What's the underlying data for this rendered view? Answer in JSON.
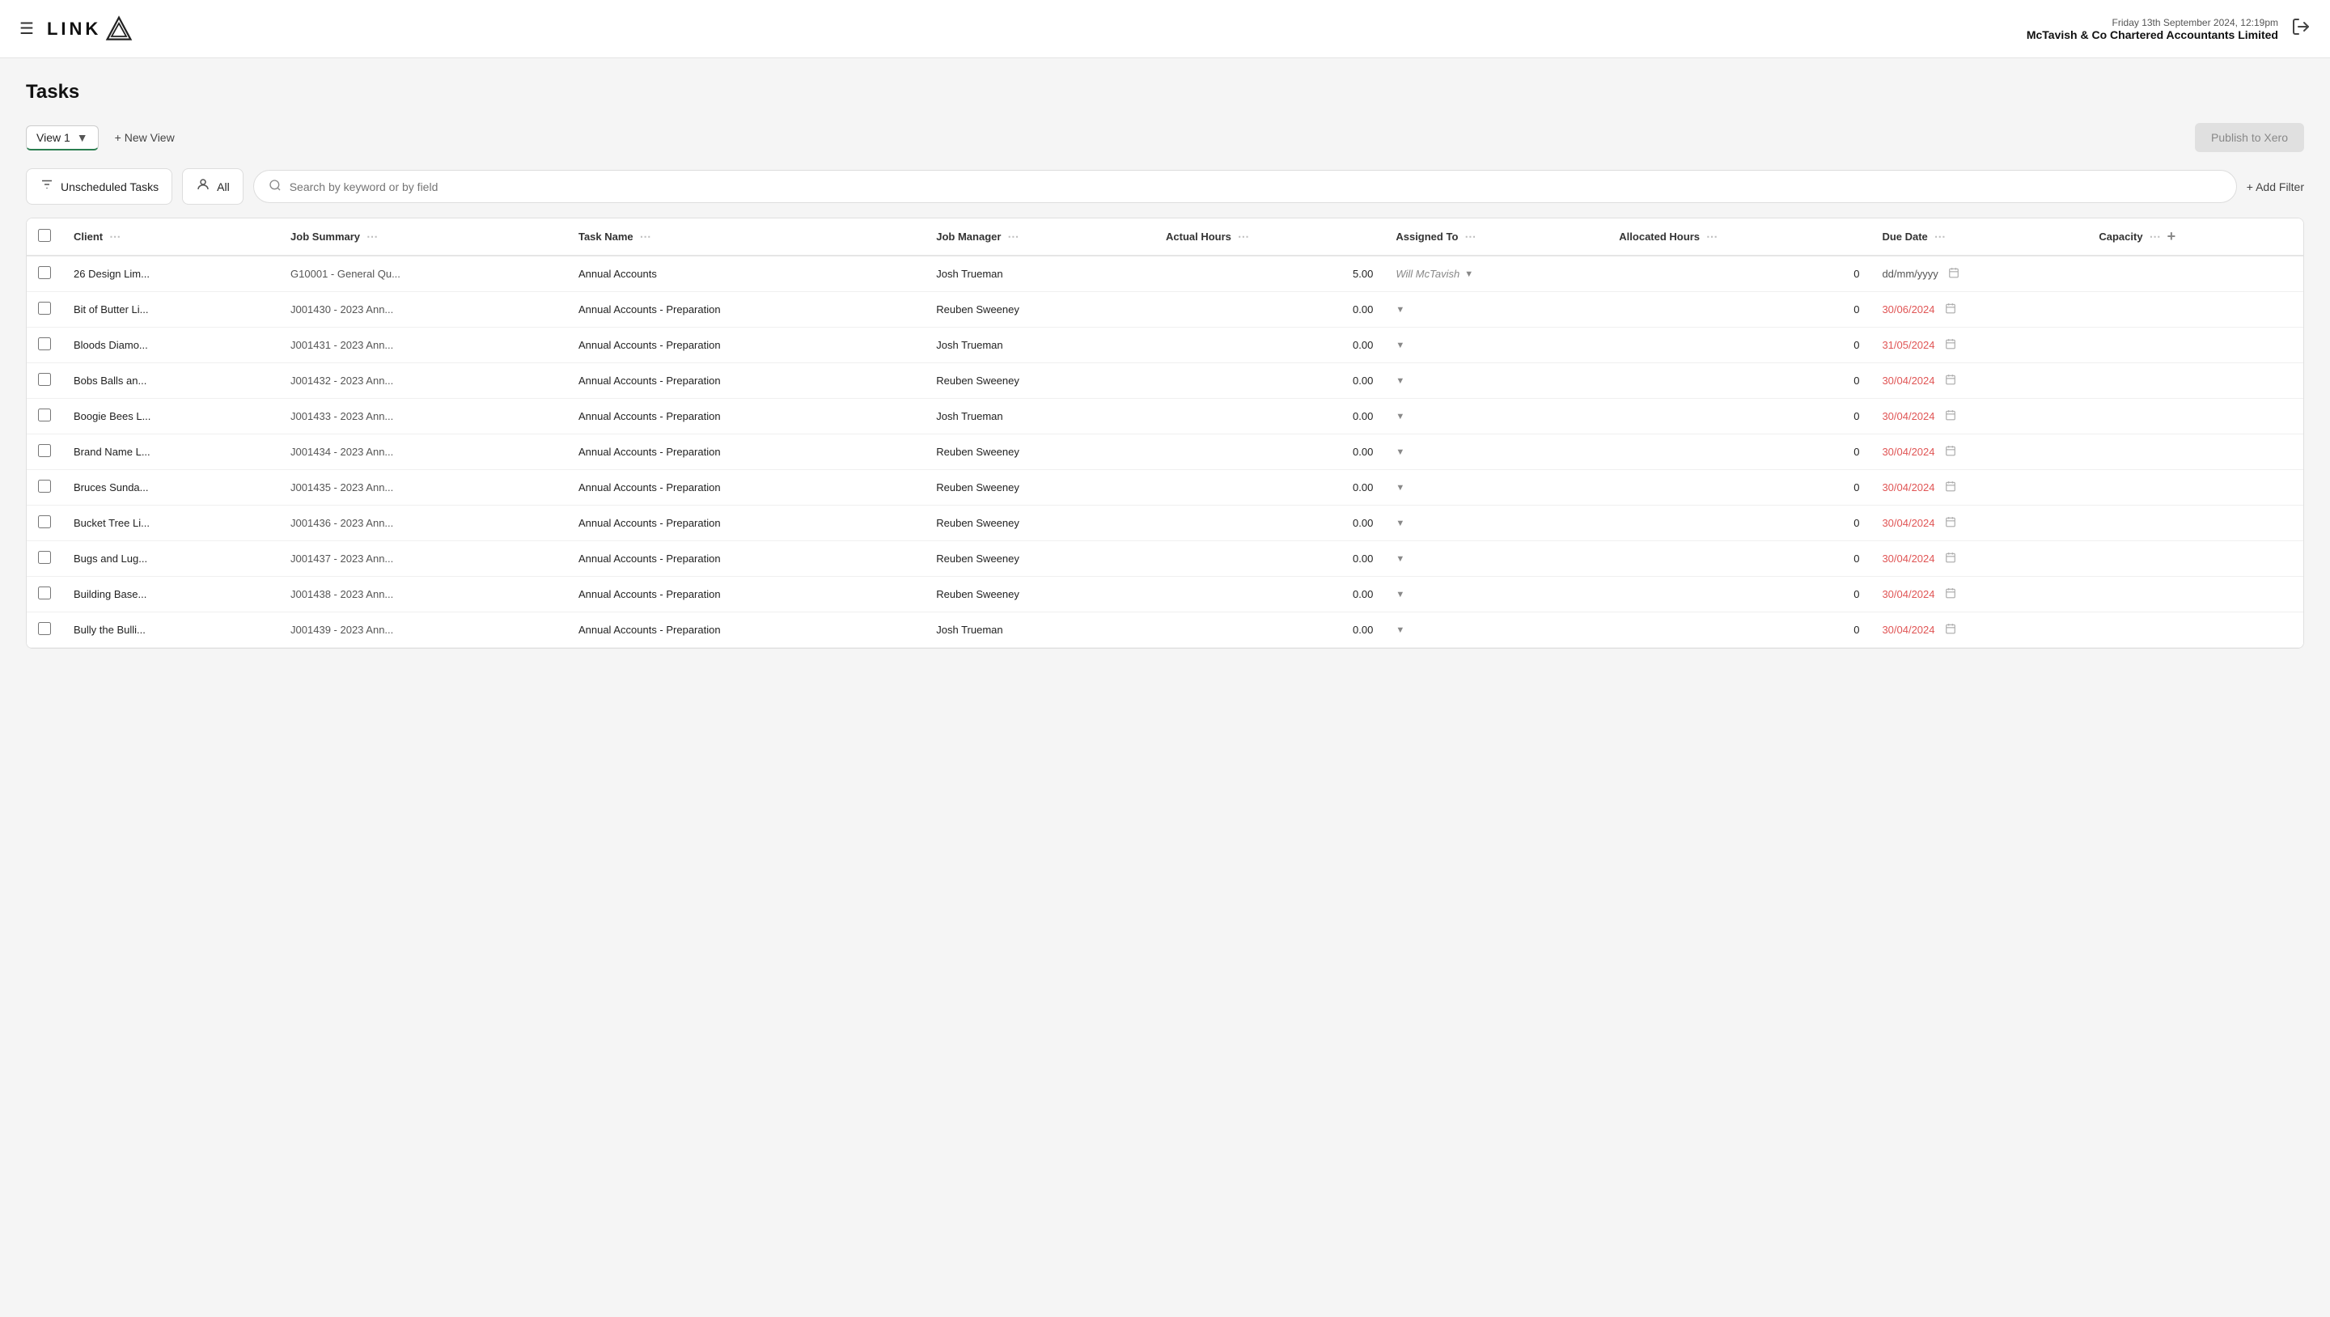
{
  "header": {
    "menu_label": "☰",
    "logo_text": "LINK",
    "date": "Friday 13th September 2024, 12:19pm",
    "company": "McTavish & Co Chartered Accountants Limited",
    "logout_icon": "→"
  },
  "page": {
    "title": "Tasks"
  },
  "toolbar": {
    "view_label": "View 1",
    "new_view_label": "+ New View",
    "publish_label": "Publish to Xero"
  },
  "filters": {
    "filter_label": "Unscheduled Tasks",
    "person_label": "All",
    "search_placeholder": "Search by keyword or by field",
    "add_filter_label": "+ Add Filter"
  },
  "table": {
    "columns": [
      {
        "id": "client",
        "label": "Client"
      },
      {
        "id": "job_summary",
        "label": "Job Summary"
      },
      {
        "id": "task_name",
        "label": "Task Name"
      },
      {
        "id": "job_manager",
        "label": "Job Manager"
      },
      {
        "id": "actual_hours",
        "label": "Actual Hours"
      },
      {
        "id": "assigned_to",
        "label": "Assigned To"
      },
      {
        "id": "allocated_hours",
        "label": "Allocated Hours"
      },
      {
        "id": "due_date",
        "label": "Due Date"
      },
      {
        "id": "capacity",
        "label": "Capacity"
      }
    ],
    "rows": [
      {
        "client": "26 Design Lim...",
        "job_summary": "G10001 - General Qu...",
        "task_name": "Annual Accounts",
        "job_manager": "Josh Trueman",
        "actual_hours": "5.00",
        "assigned_to": "Will McTavish",
        "assigned_placeholder": false,
        "allocated_hours": "0",
        "due_date": "dd/mm/yyyy",
        "due_date_overdue": false,
        "capacity": ""
      },
      {
        "client": "Bit of Butter Li...",
        "job_summary": "J001430 - 2023 Ann...",
        "task_name": "Annual Accounts - Preparation",
        "job_manager": "Reuben Sweeney",
        "actual_hours": "0.00",
        "assigned_to": "",
        "assigned_placeholder": true,
        "allocated_hours": "0",
        "due_date": "30/06/2024",
        "due_date_overdue": true,
        "capacity": ""
      },
      {
        "client": "Bloods Diamo...",
        "job_summary": "J001431 - 2023 Ann...",
        "task_name": "Annual Accounts - Preparation",
        "job_manager": "Josh Trueman",
        "actual_hours": "0.00",
        "assigned_to": "",
        "assigned_placeholder": true,
        "allocated_hours": "0",
        "due_date": "31/05/2024",
        "due_date_overdue": true,
        "capacity": ""
      },
      {
        "client": "Bobs Balls an...",
        "job_summary": "J001432 - 2023 Ann...",
        "task_name": "Annual Accounts - Preparation",
        "job_manager": "Reuben Sweeney",
        "actual_hours": "0.00",
        "assigned_to": "",
        "assigned_placeholder": true,
        "allocated_hours": "0",
        "due_date": "30/04/2024",
        "due_date_overdue": true,
        "capacity": ""
      },
      {
        "client": "Boogie Bees L...",
        "job_summary": "J001433 - 2023 Ann...",
        "task_name": "Annual Accounts - Preparation",
        "job_manager": "Josh Trueman",
        "actual_hours": "0.00",
        "assigned_to": "",
        "assigned_placeholder": true,
        "allocated_hours": "0",
        "due_date": "30/04/2024",
        "due_date_overdue": true,
        "capacity": ""
      },
      {
        "client": "Brand Name L...",
        "job_summary": "J001434 - 2023 Ann...",
        "task_name": "Annual Accounts - Preparation",
        "job_manager": "Reuben Sweeney",
        "actual_hours": "0.00",
        "assigned_to": "",
        "assigned_placeholder": true,
        "allocated_hours": "0",
        "due_date": "30/04/2024",
        "due_date_overdue": true,
        "capacity": ""
      },
      {
        "client": "Bruces Sunda...",
        "job_summary": "J001435 - 2023 Ann...",
        "task_name": "Annual Accounts - Preparation",
        "job_manager": "Reuben Sweeney",
        "actual_hours": "0.00",
        "assigned_to": "",
        "assigned_placeholder": true,
        "allocated_hours": "0",
        "due_date": "30/04/2024",
        "due_date_overdue": true,
        "capacity": ""
      },
      {
        "client": "Bucket Tree Li...",
        "job_summary": "J001436 - 2023 Ann...",
        "task_name": "Annual Accounts - Preparation",
        "job_manager": "Reuben Sweeney",
        "actual_hours": "0.00",
        "assigned_to": "",
        "assigned_placeholder": true,
        "allocated_hours": "0",
        "due_date": "30/04/2024",
        "due_date_overdue": true,
        "capacity": ""
      },
      {
        "client": "Bugs and Lug...",
        "job_summary": "J001437 - 2023 Ann...",
        "task_name": "Annual Accounts - Preparation",
        "job_manager": "Reuben Sweeney",
        "actual_hours": "0.00",
        "assigned_to": "",
        "assigned_placeholder": true,
        "allocated_hours": "0",
        "due_date": "30/04/2024",
        "due_date_overdue": true,
        "capacity": ""
      },
      {
        "client": "Building Base...",
        "job_summary": "J001438 - 2023 Ann...",
        "task_name": "Annual Accounts - Preparation",
        "job_manager": "Reuben Sweeney",
        "actual_hours": "0.00",
        "assigned_to": "",
        "assigned_placeholder": true,
        "allocated_hours": "0",
        "due_date": "30/04/2024",
        "due_date_overdue": true,
        "capacity": ""
      },
      {
        "client": "Bully the Bulli...",
        "job_summary": "J001439 - 2023 Ann...",
        "task_name": "Annual Accounts - Preparation",
        "job_manager": "Josh Trueman",
        "actual_hours": "0.00",
        "assigned_to": "",
        "assigned_placeholder": true,
        "allocated_hours": "0",
        "due_date": "30/04/2024",
        "due_date_overdue": true,
        "capacity": ""
      }
    ]
  }
}
